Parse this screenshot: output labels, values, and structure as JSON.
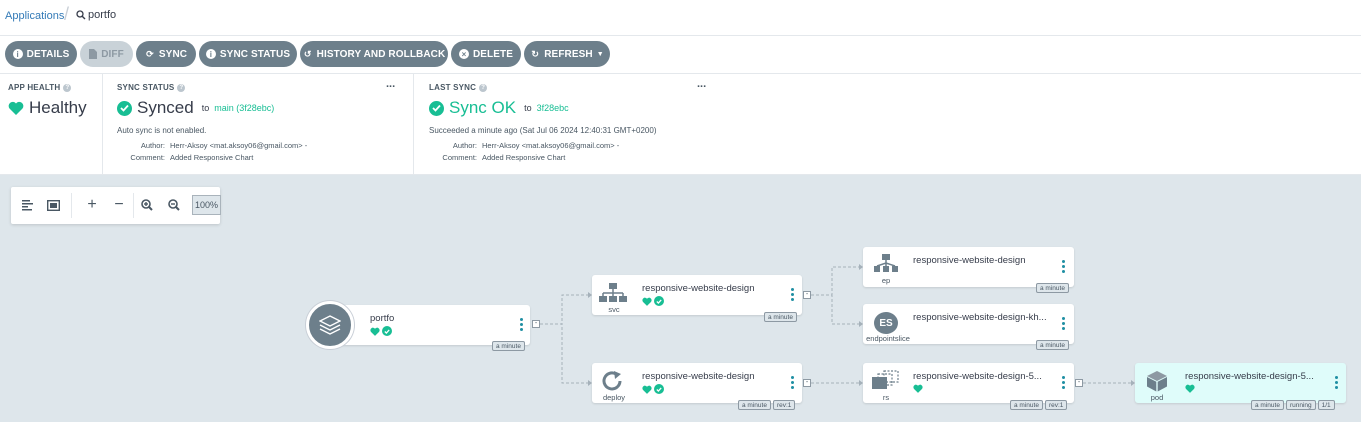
{
  "breadcrumb": {
    "applications": "Applications",
    "current": "portfo"
  },
  "toolbar": {
    "details": "DETAILS",
    "diff": "DIFF",
    "sync": "SYNC",
    "sync_status": "SYNC STATUS",
    "history": "HISTORY AND ROLLBACK",
    "delete": "DELETE",
    "refresh": "REFRESH"
  },
  "app_health": {
    "title": "APP HEALTH",
    "value": "Healthy"
  },
  "sync_status": {
    "title": "SYNC STATUS",
    "value": "Synced",
    "to_label": "to",
    "revision": "main (3f28ebc)",
    "auto_sync": "Auto sync is not enabled.",
    "author_label": "Author:",
    "author": "Herr-Aksoy <mat.aksoy06@gmail.com> -",
    "comment_label": "Comment:",
    "comment": "Added Responsive Chart",
    "more": "..."
  },
  "last_sync": {
    "title": "LAST SYNC",
    "value": "Sync OK",
    "to_label": "to",
    "revision": "3f28ebc",
    "succeeded": "Succeeded a minute ago (Sat Jul 06 2024 12:40:31 GMT+0200)",
    "author_label": "Author:",
    "author": "Herr-Aksoy <mat.aksoy06@gmail.com> -",
    "comment_label": "Comment:",
    "comment": "Added Responsive Chart",
    "more": "..."
  },
  "graph_tools": {
    "zoom": "100%"
  },
  "colors": {
    "accent": "#18be94",
    "button": "#6d7f8b",
    "link": "#337ab7",
    "graph_bg": "#dee6eb"
  },
  "nodes": {
    "app": {
      "name": "portfo",
      "age": "a minute"
    },
    "svc": {
      "name": "responsive-website-design",
      "kind": "svc",
      "age": "a minute"
    },
    "deploy": {
      "name": "responsive-website-design",
      "kind": "deploy",
      "age": "a minute",
      "rev": "rev:1"
    },
    "ep": {
      "name": "responsive-website-design",
      "kind": "ep",
      "age": "a minute"
    },
    "endpointslice": {
      "name": "responsive-website-design-kh...",
      "kind": "endpointslice",
      "icon_text": "ES",
      "age": "a minute"
    },
    "rs": {
      "name": "responsive-website-design-5...",
      "kind": "rs",
      "age": "a minute",
      "rev": "rev:1"
    },
    "pod": {
      "name": "responsive-website-design-5...",
      "kind": "pod",
      "age": "a minute",
      "status": "running",
      "ready": "1/1"
    }
  }
}
